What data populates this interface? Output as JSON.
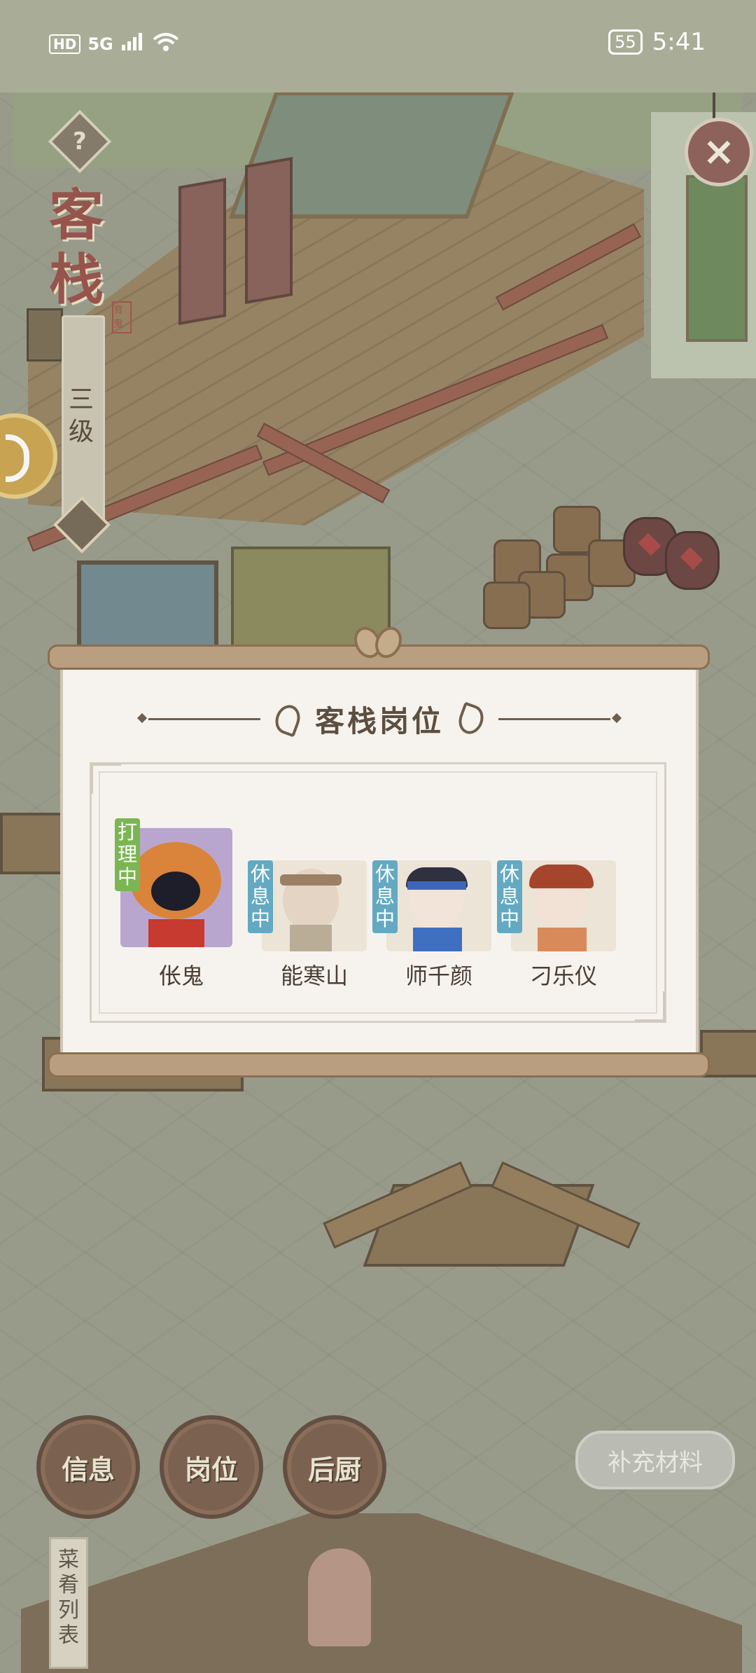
{
  "status_bar": {
    "hd": "HD",
    "network": "5G",
    "battery": "55",
    "time": "5:41"
  },
  "inn": {
    "title_chars": [
      "客",
      "栈"
    ],
    "seal": "育鬼",
    "level": "三级"
  },
  "dialog": {
    "title": "客栈岗位",
    "staff": [
      {
        "name": "伥鬼",
        "status": "打理中",
        "active": true
      },
      {
        "name": "能寒山",
        "status": "休息中",
        "active": false
      },
      {
        "name": "师千颜",
        "status": "休息中",
        "active": false
      },
      {
        "name": "刁乐仪",
        "status": "休息中",
        "active": false
      }
    ]
  },
  "bottom": {
    "info": "信息",
    "positions": "岗位",
    "kitchen": "后厨",
    "supply": "补充材料",
    "menu_list": "菜肴列表"
  },
  "icons": {
    "help": "question-icon",
    "close": "close-icon",
    "coin": "coin-icon"
  }
}
